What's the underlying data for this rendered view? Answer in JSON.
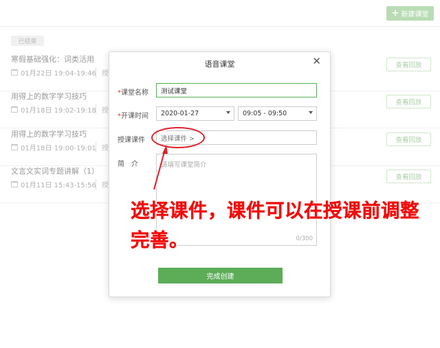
{
  "header": {
    "new_button_label": "新建课堂",
    "plus_glyph": "+"
  },
  "ended_badge": "已结束",
  "lessons": [
    {
      "title": "寒假基础强化：词类活用",
      "time": "01月22日 19:04-19:46",
      "extra": "授",
      "replay_label": "查看回放"
    },
    {
      "title": "用得上的数字学习技巧",
      "time": "01月18日 19:02-19:18",
      "extra": "授",
      "replay_label": "查看回放"
    },
    {
      "title": "用得上的数字学习技巧",
      "time": "01月18日 19:00-19:01",
      "extra": "授",
      "replay_label": "查看回放"
    },
    {
      "title": "文言文实词专题讲解（1）",
      "time": "01月11日 15:43-15:56",
      "extra": "授",
      "replay_label": "查看回放"
    }
  ],
  "modal": {
    "title": "语音课堂",
    "close_glyph": "✕",
    "required_mark": "*",
    "name_label": "课堂名称",
    "name_value": "测试课堂",
    "time_label": "开课时间",
    "date_value": "2020-01-27",
    "time_range_value": "09:05 - 09:50",
    "courseware_label": "授课课件",
    "courseware_link": "选择课件 >",
    "intro_label": "简　介",
    "intro_placeholder": "请填写课堂简介",
    "intro_counter": "0/300",
    "submit_label": "完成创建"
  },
  "annotation_text": "选择课件，课件可以在授课前调整完善。",
  "colors": {
    "accent_green": "#5cac58",
    "annotation_red": "#f20d0d"
  }
}
